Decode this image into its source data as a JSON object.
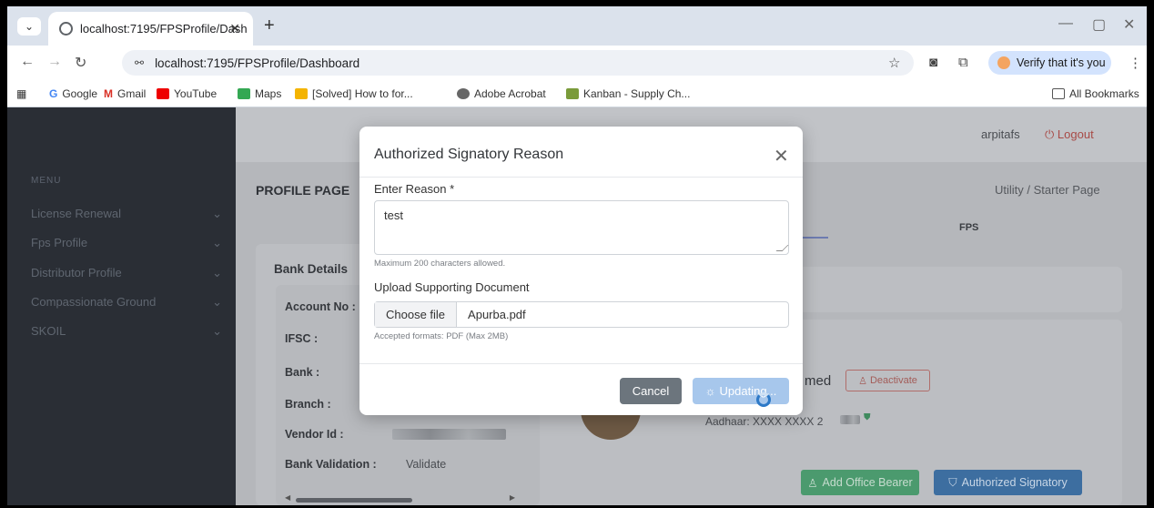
{
  "browser": {
    "tab_title": "localhost:7195/FPSProfile/Dash",
    "address": "localhost:7195/FPSProfile/Dashboard",
    "profile_button": "Verify that it's you",
    "bookmarks": [
      "Google",
      "Gmail",
      "YouTube",
      "Maps",
      "[Solved] How to for...",
      "Adobe Acrobat",
      "Kanban - Supply Ch..."
    ],
    "all_bookmarks": "All Bookmarks"
  },
  "sidebar": {
    "heading": "MENU",
    "items": [
      {
        "label": "License Renewal"
      },
      {
        "label": "Fps Profile"
      },
      {
        "label": "Distributor Profile"
      },
      {
        "label": "Compassionate Ground"
      },
      {
        "label": "SKOIL"
      }
    ]
  },
  "header": {
    "user": "arpitafs",
    "logout": "Logout"
  },
  "page": {
    "title": "PROFILE PAGE",
    "breadcrumb": "Utility  /  Starter Page",
    "tab_fps": "FPS"
  },
  "bank": {
    "title": "Bank Details",
    "account": "Account No :",
    "ifsc": "IFSC :",
    "bank": "Bank :",
    "branch": "Branch :",
    "vendor": "Vendor Id :",
    "validation_label": "Bank Validation :",
    "validation_value": "Validate"
  },
  "profile": {
    "name_fragment": "med",
    "deactivate": "Deactivate",
    "aadhaar": "Aadhaar: XXXX XXXX 2",
    "add_office_bearer": "Add Office Bearer",
    "authorized_signatory": "Authorized Signatory"
  },
  "modal": {
    "title": "Authorized Signatory Reason",
    "reason_label": "Enter Reason *",
    "reason_value": "test",
    "reason_hint": "Maximum 200 characters allowed.",
    "upload_label": "Upload Supporting Document",
    "choose_file": "Choose file",
    "file_name": "Apurba.pdf",
    "upload_hint": "Accepted formats: PDF (Max 2MB)",
    "cancel": "Cancel",
    "updating": "Updating..."
  },
  "colors": {
    "sidebar": "#2a2e35",
    "primary": "#3d6ea0",
    "success": "#4b9a6e",
    "danger": "#a84a46"
  }
}
